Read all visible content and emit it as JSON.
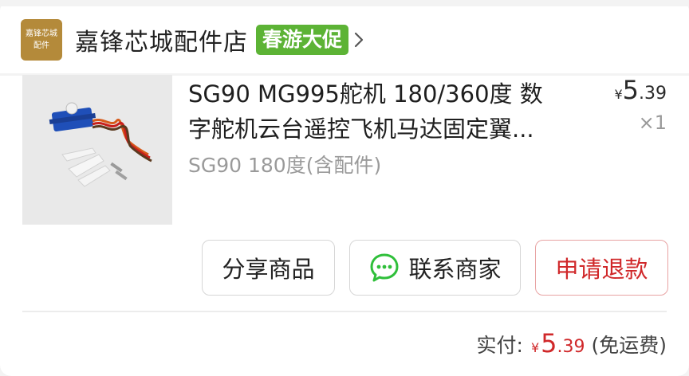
{
  "shop": {
    "logo_text_line1": "嘉锋芯城",
    "logo_text_line2": "配件",
    "name": "嘉锋芯城配件店",
    "promo_badge": "春游大促"
  },
  "product": {
    "title_line1": "SG90 MG995舵机 180/360度 数",
    "title_line2": "字舵机云台遥控飞机马达固定翼...",
    "spec": "SG90 180度(含配件)",
    "price": {
      "symbol": "¥",
      "integer": "5",
      "decimal": ".39"
    },
    "quantity": "×1"
  },
  "actions": {
    "share": "分享商品",
    "contact": "联系商家",
    "refund": "申请退款"
  },
  "total": {
    "label": "实付:",
    "symbol": "¥",
    "integer": "5",
    "decimal": ".39",
    "note": "(免运费)"
  },
  "colors": {
    "accent_red": "#d0282a",
    "promo_green": "#5cb335",
    "logo_gold": "#b48a3a",
    "chat_icon_green": "#2fbf3a"
  },
  "icons": [
    "chevron-right-icon",
    "chat-bubble-icon"
  ]
}
